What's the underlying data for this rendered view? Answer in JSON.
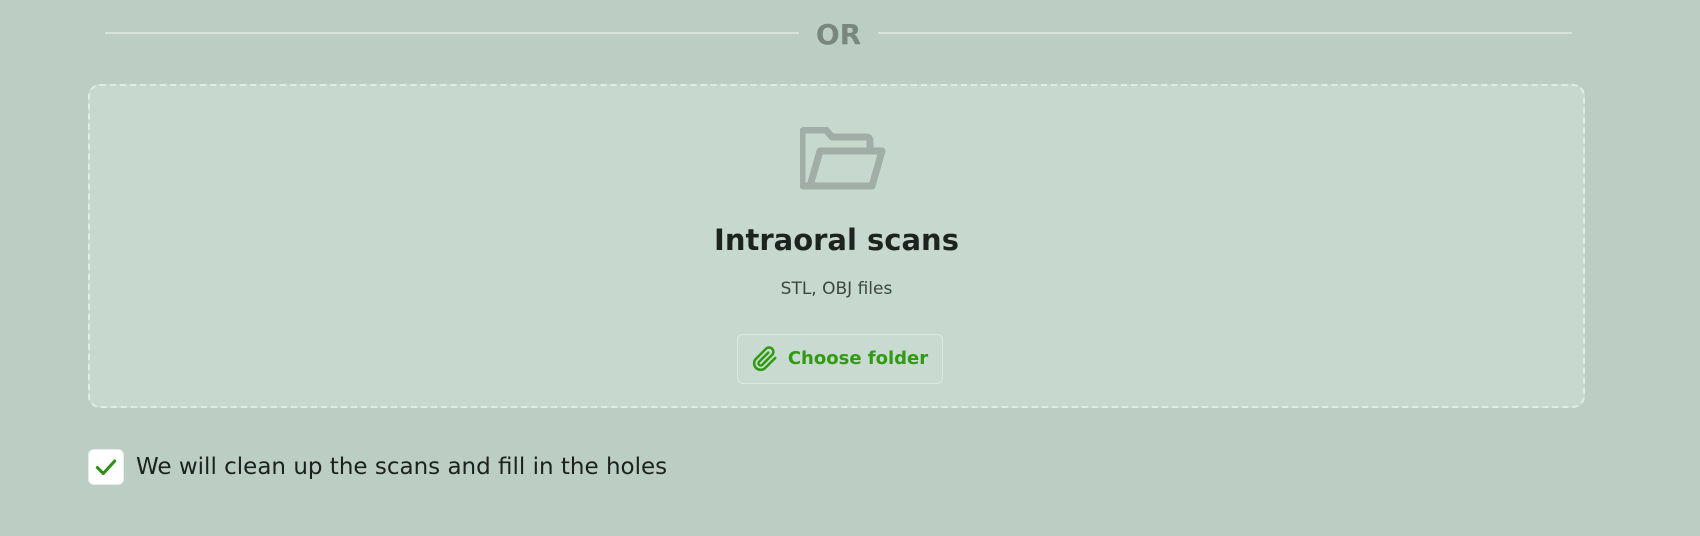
{
  "divider": {
    "text": "OR"
  },
  "upload": {
    "icon": "folder-open-icon",
    "title": "Intraoral scans",
    "subtitle": "STL, OBJ files",
    "button": {
      "icon": "paperclip-icon",
      "label": "Choose folder"
    }
  },
  "cleanup_option": {
    "checked": true,
    "label": "We will clean up the scans and fill in the holes"
  },
  "colors": {
    "background": "#bccec3",
    "dropzone": "#c7d9ce",
    "accent": "#2f9a12",
    "icon_muted": "#a1aea7"
  }
}
